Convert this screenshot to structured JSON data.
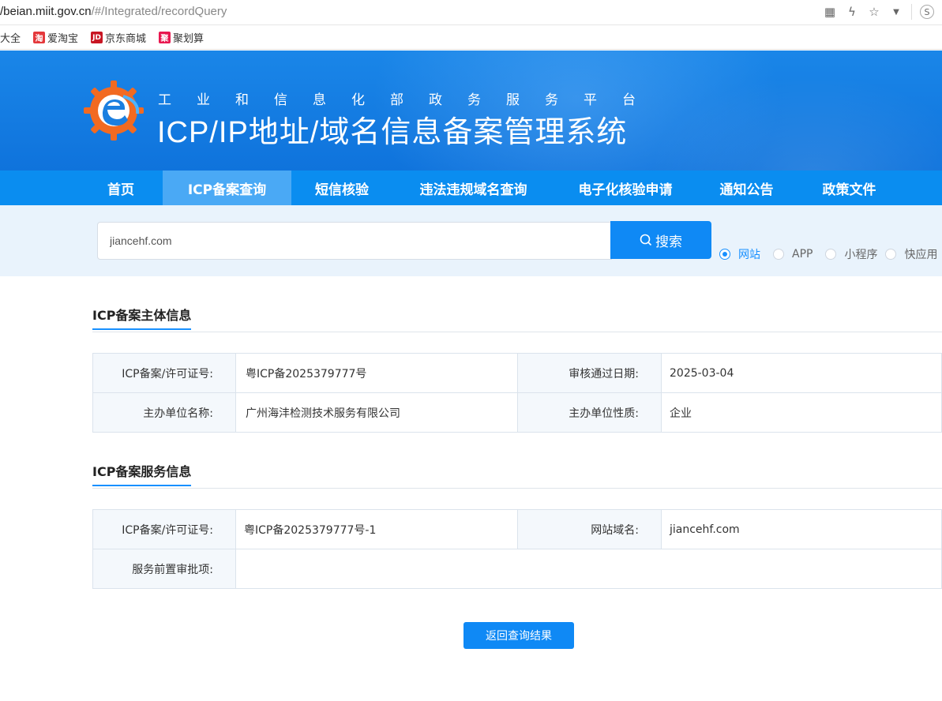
{
  "browser": {
    "url_host": "/beian.miit.gov.cn",
    "url_path": "/#/Integrated/recordQuery",
    "bookmarks": [
      {
        "label": "大全",
        "icon": ""
      },
      {
        "label": "爱淘宝",
        "icon": "淘",
        "color": "#e4393c"
      },
      {
        "label": "京东商城",
        "icon": "JD",
        "color": "#c81623"
      },
      {
        "label": "聚划算",
        "icon": "聚",
        "color": "#e8174f"
      }
    ]
  },
  "header": {
    "subtitle": "工业和信息化部政务服务平台",
    "title": "ICP/IP地址/域名信息备案管理系统"
  },
  "nav": {
    "items": [
      {
        "label": "首页"
      },
      {
        "label": "ICP备案查询"
      },
      {
        "label": "短信核验"
      },
      {
        "label": "违法违规域名查询"
      },
      {
        "label": "电子化核验申请"
      },
      {
        "label": "通知公告"
      },
      {
        "label": "政策文件"
      }
    ],
    "active_index": 1
  },
  "search": {
    "value": "jiancehf.com",
    "button_label": "搜索",
    "types": [
      "网站",
      "APP",
      "小程序",
      "快应用"
    ],
    "selected": "网站"
  },
  "subject_info": {
    "title": "ICP备案主体信息",
    "license_label": "ICP备案/许可证号:",
    "license_value": "粤ICP备2025379777号",
    "date_label": "审核通过日期:",
    "date_value": "2025-03-04",
    "org_label": "主办单位名称:",
    "org_value": "广州海沣检测技术服务有限公司",
    "nature_label": "主办单位性质:",
    "nature_value": "企业"
  },
  "service_info": {
    "title": "ICP备案服务信息",
    "license_label": "ICP备案/许可证号:",
    "license_value": "粤ICP备2025379777号-1",
    "domain_label": "网站域名:",
    "domain_value": "jiancehf.com",
    "approval_label": "服务前置审批项:",
    "approval_value": ""
  },
  "back_button": "返回查询结果",
  "colors": {
    "primary": "#0f89f5",
    "nav_bg": "#0a8df0",
    "nav_active": "#4aa9f5",
    "banner": "#1a86e8"
  }
}
